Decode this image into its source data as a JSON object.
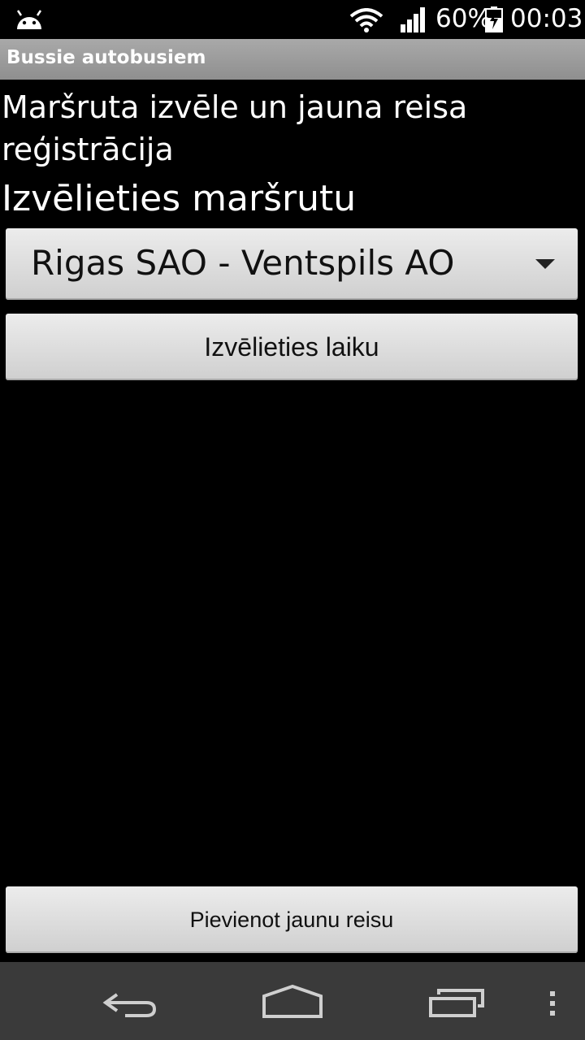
{
  "status_bar": {
    "battery": "60%",
    "time": "00:03",
    "icons": [
      "android-icon",
      "wifi-icon",
      "signal-icon",
      "battery-charging-icon"
    ]
  },
  "action_bar": {
    "title": "Bussie autobusiem"
  },
  "main": {
    "title": "Maršruta izvēle un jauna reisa reģistrācija",
    "route_label": "Izvēlieties maršrutu",
    "route_selected": "Rigas SAO - Ventspils AO",
    "time_button": "Izvēlieties laiku",
    "add_button": "Pievienot jaunu reisu"
  },
  "nav_bar": {
    "icons": [
      "back-icon",
      "home-icon",
      "recent-apps-icon",
      "menu-icon"
    ]
  }
}
